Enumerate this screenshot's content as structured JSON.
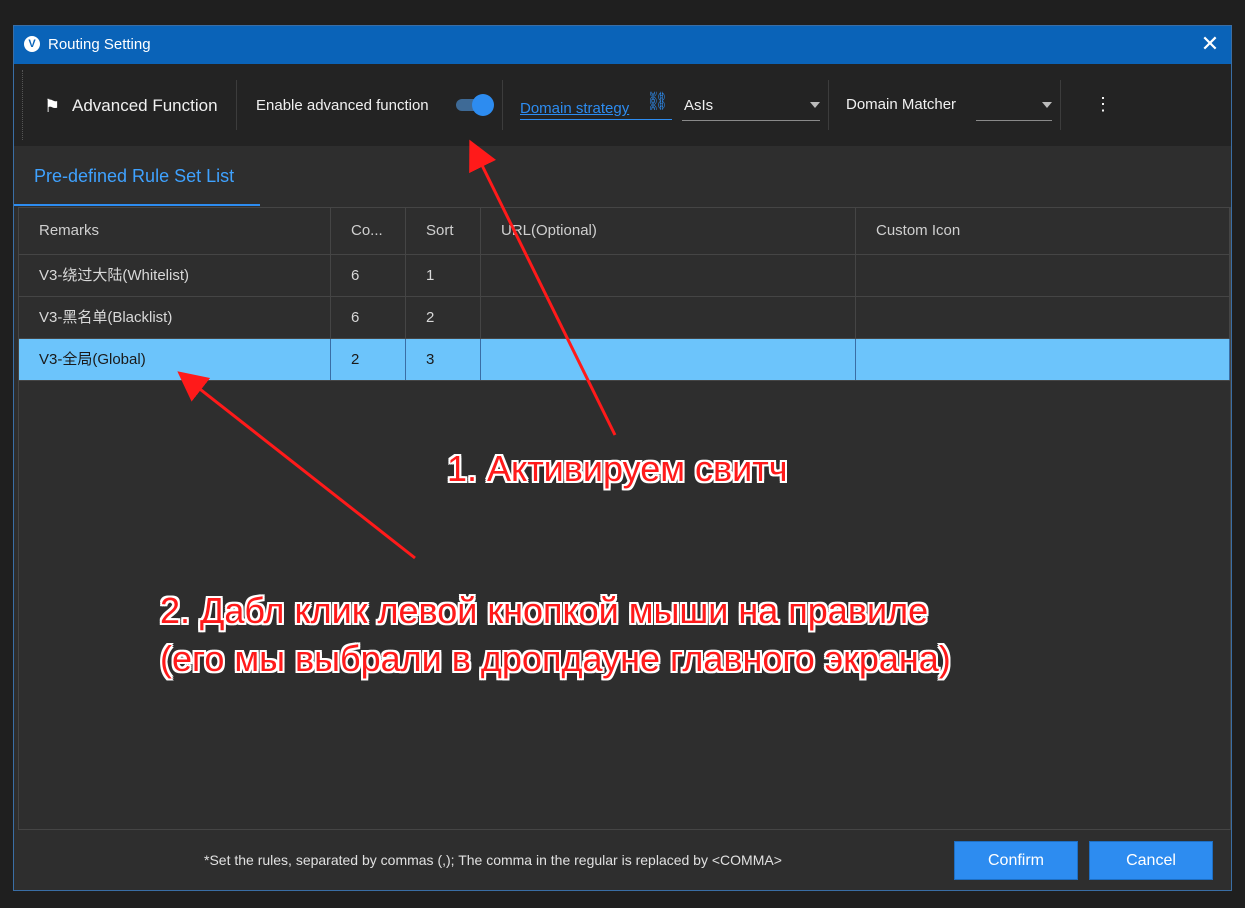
{
  "window": {
    "title": "Routing Setting"
  },
  "toolbar": {
    "advanced_label": "Advanced Function",
    "enable_label": "Enable advanced function",
    "enable_toggle_on": true,
    "domain_strategy_link": "Domain strategy",
    "domain_strategy_value": "AsIs",
    "domain_matcher_label": "Domain Matcher",
    "domain_matcher_value": ""
  },
  "tabs": [
    {
      "label": "Pre-defined Rule Set List",
      "active": true
    }
  ],
  "table": {
    "columns": [
      "Remarks",
      "Co...",
      "Sort",
      "URL(Optional)",
      "Custom Icon"
    ],
    "rows": [
      {
        "remarks": "V3-绕过大陆(Whitelist)",
        "count": "6",
        "sort": "1",
        "url": "",
        "icon": ""
      },
      {
        "remarks": "V3-黑名单(Blacklist)",
        "count": "6",
        "sort": "2",
        "url": "",
        "icon": ""
      },
      {
        "remarks": "V3-全局(Global)",
        "count": "2",
        "sort": "3",
        "url": "",
        "icon": "",
        "selected": true
      }
    ]
  },
  "footer": {
    "note": "*Set the rules, separated by commas (,); The comma in the regular is replaced by <COMMA>",
    "confirm_label": "Confirm",
    "cancel_label": "Cancel"
  },
  "annotations": {
    "step1": "1. Активируем свитч",
    "step2_line1": "2. Дабл клик левой кнопкой мыши на правиле",
    "step2_line2": "(его мы выбрали в дропдауне главного экрана)"
  },
  "colors": {
    "accent": "#2d8cf0",
    "titlebar": "#0a63b8",
    "selected_row": "#6cc4fb",
    "annotation": "#ff1a1a"
  }
}
